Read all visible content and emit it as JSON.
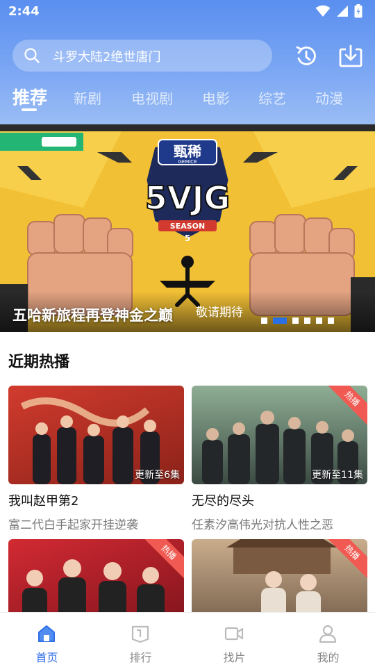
{
  "status_bar": {
    "time": "2:44"
  },
  "search": {
    "query": "斗罗大陆2绝世唐门"
  },
  "tabs": [
    {
      "label": "推荐",
      "active": true
    },
    {
      "label": "新剧",
      "active": false
    },
    {
      "label": "电视剧",
      "active": false
    },
    {
      "label": "电影",
      "active": false
    },
    {
      "label": "综艺",
      "active": false
    },
    {
      "label": "动漫",
      "active": false
    }
  ],
  "banner": {
    "caption": "五哈新旅程再登神金之巅",
    "subcaption": "敬请期待",
    "logo_text": "甄稀",
    "logo_subtext": "GEMICE",
    "show_mark": "5VJG",
    "season_text": "SEASON",
    "season_number": "5",
    "page_count": 6,
    "active_page": 2
  },
  "section": {
    "title": "近期热播"
  },
  "cards": [
    {
      "title": "我叫赵甲第2",
      "subtitle": "富二代白手起家开挂逆袭",
      "episode": "更新至6集",
      "hot": "",
      "colors": [
        "#c0362c",
        "#7a1f1a"
      ]
    },
    {
      "title": "无尽的尽头",
      "subtitle": "任素汐高伟光对抗人性之恶",
      "episode": "更新至11集",
      "hot": "热播",
      "colors": [
        "#6f8f7a",
        "#2f3b36"
      ]
    },
    {
      "title": "",
      "subtitle": "",
      "episode": "",
      "hot": "热播",
      "colors": [
        "#c8262f",
        "#6e1118"
      ]
    },
    {
      "title": "",
      "subtitle": "",
      "episode": "",
      "hot": "热播",
      "colors": [
        "#b89a7a",
        "#5e4a3a"
      ]
    }
  ],
  "bottom_nav": [
    {
      "label": "首页",
      "icon": "home-icon",
      "active": true
    },
    {
      "label": "排行",
      "icon": "ranking-icon",
      "active": false
    },
    {
      "label": "找片",
      "icon": "video-camera-icon",
      "active": false
    },
    {
      "label": "我的",
      "icon": "user-icon",
      "active": false
    }
  ],
  "colors": {
    "accent": "#2f6ee6",
    "header_top": "#5a8ff0",
    "hot_badge": "#f05a52"
  }
}
